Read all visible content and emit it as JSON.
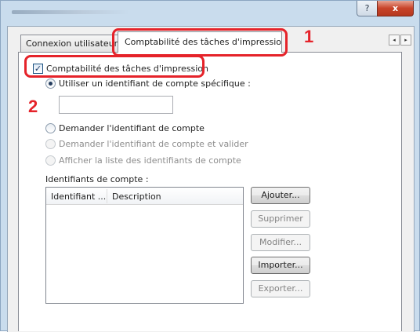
{
  "window": {
    "help_symbol": "?",
    "close_symbol": "x"
  },
  "tabs": {
    "connexion_label": "Connexion utilisateur",
    "comptabilite_label": "Comptabilité des tâches d'impression",
    "scroll_left": "◂",
    "scroll_right": "▸"
  },
  "options": {
    "enable_checkbox_label": "Comptabilité des tâches d'impression",
    "enable_checked": true,
    "specific_id_label": "Utiliser un identifiant de compte spécifique :",
    "specific_id_value": "",
    "ask_id_label": "Demander l'identifiant de compte",
    "ask_validate_label": "Demander l'identifiant de compte et valider",
    "show_list_label": "Afficher la liste des identifiants de compte",
    "selected_option": "specific_id"
  },
  "account_list": {
    "label": "Identifiants de compte :",
    "columns": [
      "Identifiant ...",
      "Description"
    ],
    "rows": []
  },
  "buttons": {
    "add": "Ajouter...",
    "delete": "Supprimer",
    "edit": "Modifier...",
    "import": "Importer...",
    "export": "Exporter..."
  },
  "callouts": {
    "one": "1",
    "two": "2"
  },
  "colors": {
    "callout_red": "#e5232a",
    "frame_blue": "#c9dced"
  }
}
